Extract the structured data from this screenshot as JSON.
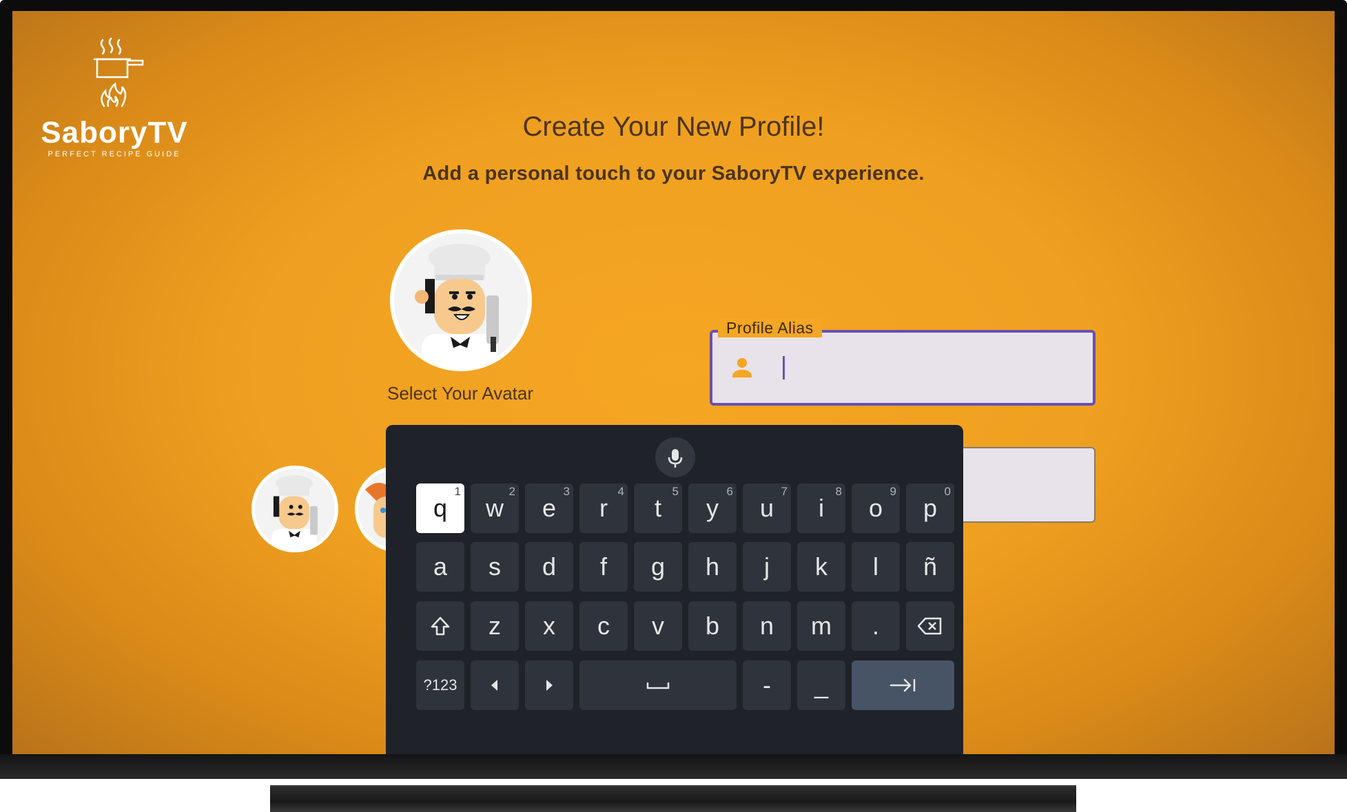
{
  "app": {
    "logo_title": "SaboryTV",
    "logo_tagline": "PERFECT RECIPE GUIDE"
  },
  "header": {
    "title": "Create Your New Profile!",
    "subtitle": "Add a personal touch to your SaboryTV experience."
  },
  "avatar": {
    "select_label": "Select Your Avatar",
    "selected": "chef-avatar",
    "options": [
      "chef-avatar",
      "chef-avatar-2"
    ]
  },
  "form": {
    "alias_label": "Profile Alias",
    "alias_value": "",
    "alias_icon": "person-icon",
    "second_field_value": ""
  },
  "colors": {
    "background": "#f5a623",
    "focus_border": "#6b4fb0",
    "keyboard_bg": "#1f2228",
    "key_bg": "#2f333b"
  },
  "keyboard": {
    "mic_icon": "mic-icon",
    "row1": [
      {
        "label": "q",
        "num": "1"
      },
      {
        "label": "w",
        "num": "2"
      },
      {
        "label": "e",
        "num": "3"
      },
      {
        "label": "r",
        "num": "4"
      },
      {
        "label": "t",
        "num": "5"
      },
      {
        "label": "y",
        "num": "6"
      },
      {
        "label": "u",
        "num": "7"
      },
      {
        "label": "i",
        "num": "8"
      },
      {
        "label": "o",
        "num": "9"
      },
      {
        "label": "p",
        "num": "0"
      }
    ],
    "row2": [
      "a",
      "s",
      "d",
      "f",
      "g",
      "h",
      "j",
      "k",
      "l",
      "ñ"
    ],
    "row3": [
      "shift",
      "z",
      "x",
      "c",
      "v",
      "b",
      "n",
      "m",
      ".",
      "backspace"
    ],
    "row4": [
      "?123",
      "left",
      "right",
      "space",
      "-",
      "_",
      "enter"
    ],
    "focused_key": "q"
  }
}
